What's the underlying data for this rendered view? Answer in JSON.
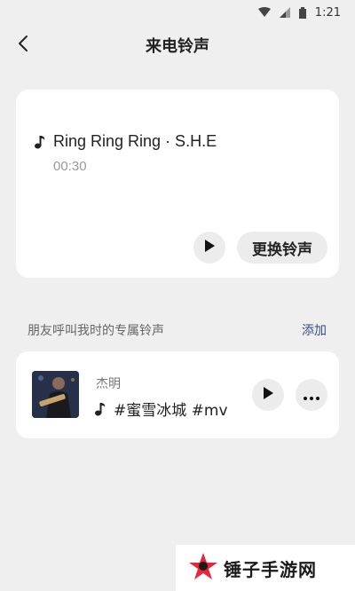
{
  "status_bar": {
    "time": "1:21"
  },
  "header": {
    "title": "来电铃声"
  },
  "current_ringtone": {
    "song_label": "Ring Ring Ring · S.H.E",
    "duration": "00:30",
    "change_label": "更换铃声"
  },
  "friends_section": {
    "label": "朋友呼叫我时的专属铃声",
    "add_label": "添加",
    "items": [
      {
        "name": "杰明",
        "song": "#蜜雪冰城 #mv"
      }
    ]
  },
  "watermark": {
    "text": "锤子手游网"
  },
  "colors": {
    "background": "#efefef",
    "card": "#ffffff",
    "accent_link": "#3a4a8a",
    "watermark_star": "#e8253a"
  }
}
